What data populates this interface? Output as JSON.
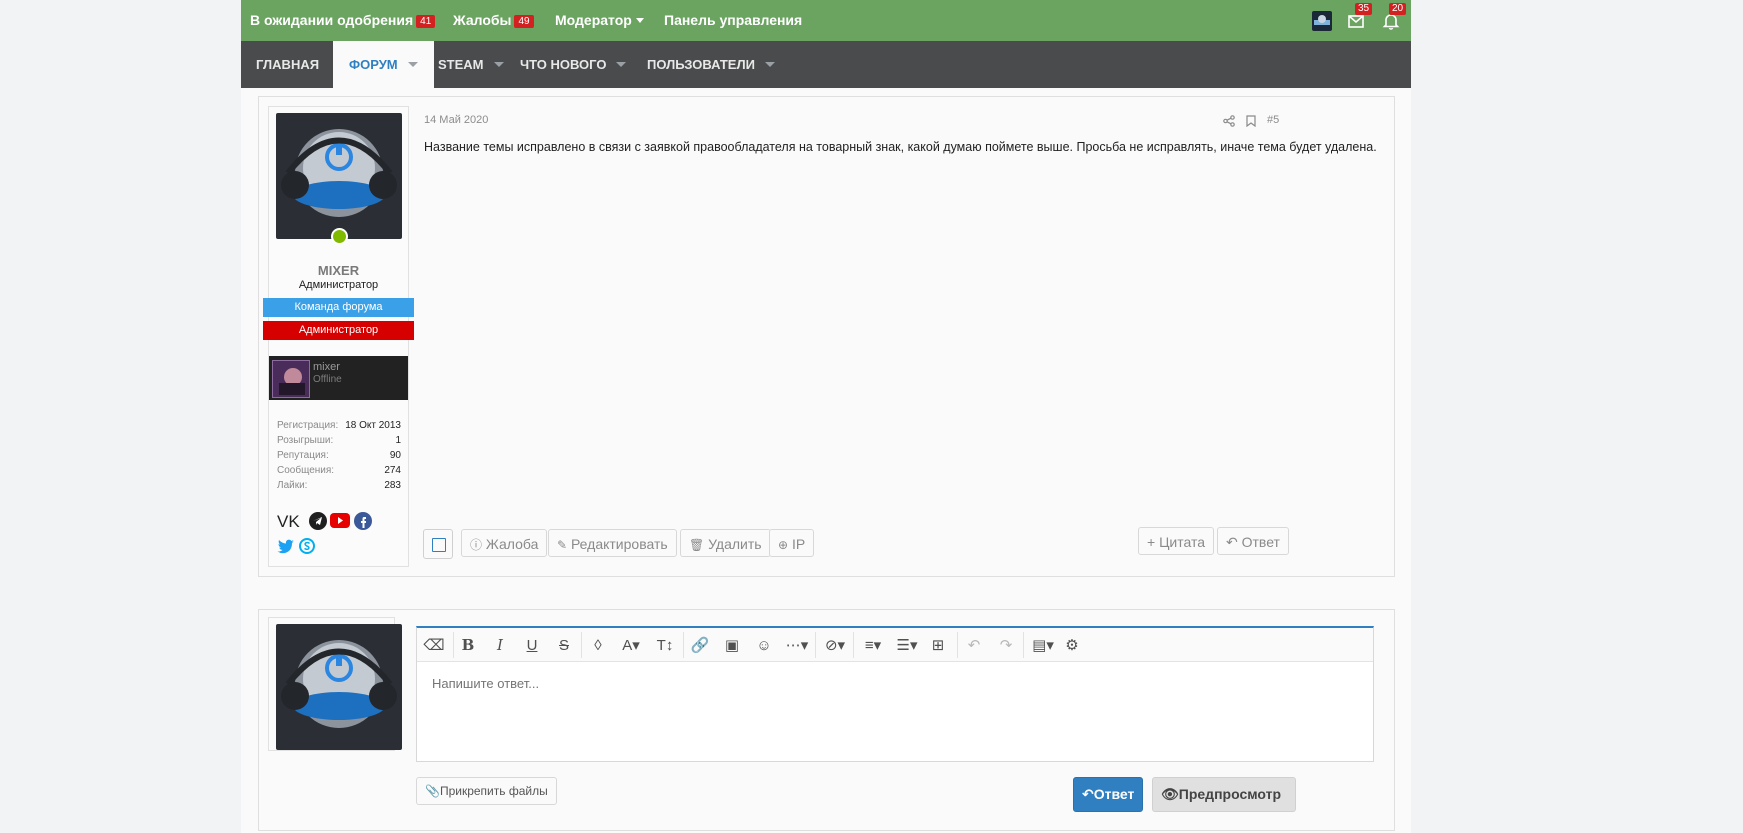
{
  "topbar": {
    "items": [
      {
        "label": "В ожидании одобрения",
        "count": "41"
      },
      {
        "label": "Жалобы",
        "count": "49"
      },
      {
        "label": "Модератор"
      },
      {
        "label": "Панель управления"
      }
    ],
    "messages_count": "35",
    "alerts_count": "20"
  },
  "nav": {
    "items": [
      "Главная",
      "Форум",
      "Steam",
      "Что нового",
      "Пользователи"
    ],
    "active": "Форум"
  },
  "post": {
    "date": "14 Май 2020",
    "number": "#5",
    "text": "Название темы исправлено в связи с заявкой правообладателя на товарный знак, какой думаю поймете выше. Просьба не исправлять, иначе тема будет удалена.",
    "user": {
      "name": "MIXER",
      "title": "Администратор",
      "banners": [
        "Команда форума",
        "Администратор"
      ],
      "steam": {
        "name": "mixer",
        "status": "Offline"
      },
      "stats": [
        {
          "label": "Регистрация:",
          "value": "18 Окт 2013"
        },
        {
          "label": "Розыгрыши:",
          "value": "1"
        },
        {
          "label": "Репутация:",
          "value": "90"
        },
        {
          "label": "Сообщения:",
          "value": "274"
        },
        {
          "label": "Лайки:",
          "value": "283"
        }
      ],
      "socials": [
        "vk-icon",
        "telegram-icon",
        "youtube-icon",
        "facebook-icon",
        "twitter-icon",
        "skype-icon"
      ],
      "vk_label": "VK"
    },
    "actions": {
      "report": "Жалоба",
      "edit": "Редактировать",
      "delete": "Удалить",
      "ip": "IP",
      "quote": "Цитата",
      "reply": "Ответ"
    }
  },
  "reply": {
    "placeholder": "Напишите ответ...",
    "attach": "Прикрепить файлы",
    "submit": "Ответ",
    "preview": "Предпросмотр"
  },
  "colors": {
    "topbar": "#6aa460",
    "navbar": "#4a4b4c",
    "accent": "#2f7fc1",
    "badge": "#d32121",
    "team_banner": "#3aa0e8",
    "admin_banner": "#d60000"
  }
}
